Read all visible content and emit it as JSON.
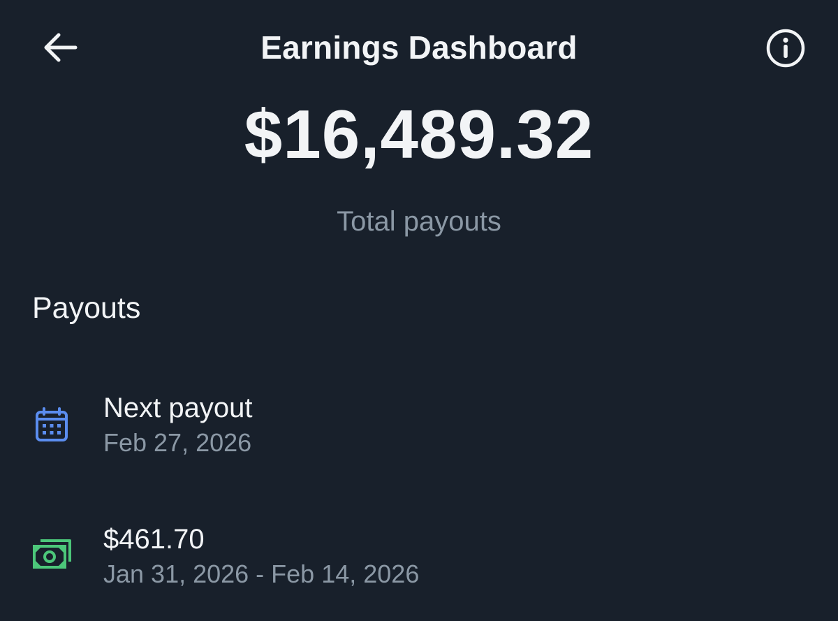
{
  "header": {
    "title": "Earnings Dashboard",
    "back_icon": "arrow-left-icon",
    "info_icon": "info-circle-icon"
  },
  "summary": {
    "total_amount": "$16,489.32",
    "total_label": "Total payouts"
  },
  "payouts": {
    "section_title": "Payouts",
    "items": [
      {
        "icon": "calendar-icon",
        "icon_color": "#5b8def",
        "title": "Next payout",
        "subtitle": "Feb 27, 2026"
      },
      {
        "icon": "cash-icon",
        "icon_color": "#4cc77a",
        "title": "$461.70",
        "subtitle": "Jan 31, 2026 - Feb 14, 2026"
      }
    ]
  },
  "colors": {
    "background": "#18202b",
    "text_primary": "#f2f4f6",
    "text_secondary": "#8b98a5"
  }
}
